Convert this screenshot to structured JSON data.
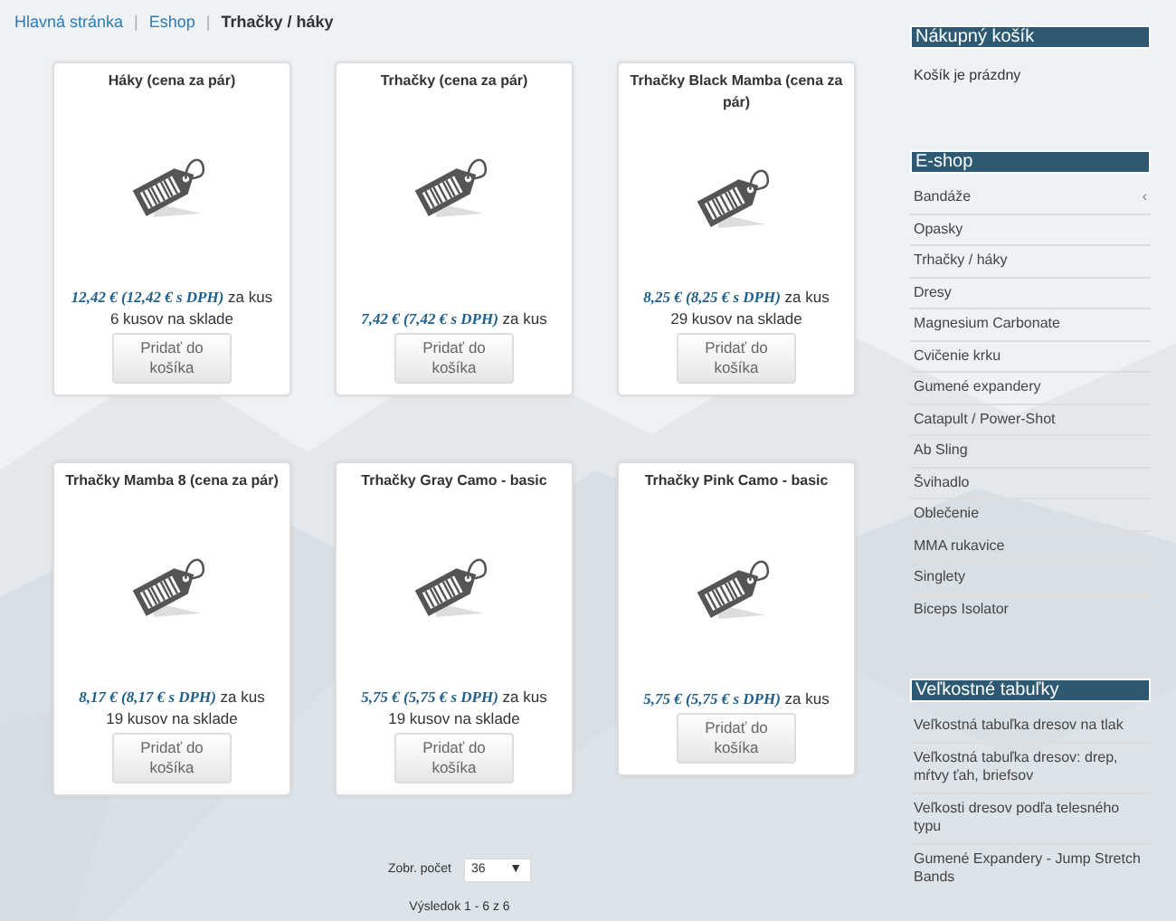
{
  "breadcrumb": [
    {
      "label": "Hlavná stránka",
      "kind": "link"
    },
    {
      "label": "Eshop",
      "kind": "link"
    },
    {
      "label": "Trhačky / háky",
      "kind": "current"
    }
  ],
  "breadcrumb_separator": "|",
  "products": [
    {
      "title": "Háky (cena za pár)",
      "price": "12,42 € (12,42 € s DPH)",
      "unit": "za kus",
      "stock": "6 kusov na sklade",
      "button": "Pridať do košíka"
    },
    {
      "title": "Trhačky (cena za pár)",
      "price": "7,42 € (7,42 € s DPH)",
      "unit": "za kus",
      "button": "Pridať do košíka"
    },
    {
      "title": "Trhačky Black Mamba (cena za pár)",
      "price": "8,25 € (8,25 € s DPH)",
      "unit": "za kus",
      "stock": "29 kusov na sklade",
      "button": "Pridať do košíka"
    },
    {
      "title": "Trhačky Mamba 8 (cena za pár)",
      "price": "8,17 € (8,17 € s DPH)",
      "unit": "za kus",
      "stock": "19 kusov na sklade",
      "button": "Pridať do košíka"
    },
    {
      "title": "Trhačky Gray Camo - basic",
      "price": "5,75 € (5,75 € s DPH)",
      "unit": "za kus",
      "stock": "19 kusov na sklade",
      "button": "Pridať do košíka"
    },
    {
      "title": "Trhačky Pink Camo - basic",
      "price": "5,75 € (5,75 € s DPH)",
      "unit": "za kus",
      "button": "Pridať do košíka"
    }
  ],
  "pager": {
    "label": "Zobr. počet",
    "value": "36",
    "arrow": "▼",
    "result": "Výsledok 1 - 6 z 6"
  },
  "sidebar": [
    {
      "title": "Nákupný košík",
      "text": "Košík je prázdny"
    },
    {
      "title": "E-shop",
      "items": [
        {
          "label": "Bandáže",
          "arrow": "‹"
        },
        {
          "label": "Opasky"
        },
        {
          "label": "Trhačky / háky"
        },
        {
          "label": "Dresy"
        },
        {
          "label": "Magnesium Carbonate"
        },
        {
          "label": "Cvičenie krku"
        },
        {
          "label": "Gumené expandery"
        },
        {
          "label": "Catapult / Power-Shot"
        },
        {
          "label": "Ab Sling"
        },
        {
          "label": "Švihadlo"
        },
        {
          "label": "Oblečenie"
        },
        {
          "label": "MMA rukavice"
        },
        {
          "label": "Singlety"
        },
        {
          "label": "Biceps Isolator"
        }
      ]
    },
    {
      "title": "Veľkostné tabuľky",
      "items": [
        {
          "label": "Veľkostná tabuľka dresov na tlak"
        },
        {
          "label": "Veľkostná tabuľka dresov: drep, mŕtvy ťah, briefsov"
        },
        {
          "label": "Veľkosti dresov podľa telesného typu"
        },
        {
          "label": "Gumené Expandery - Jump Stretch Bands"
        }
      ]
    }
  ]
}
